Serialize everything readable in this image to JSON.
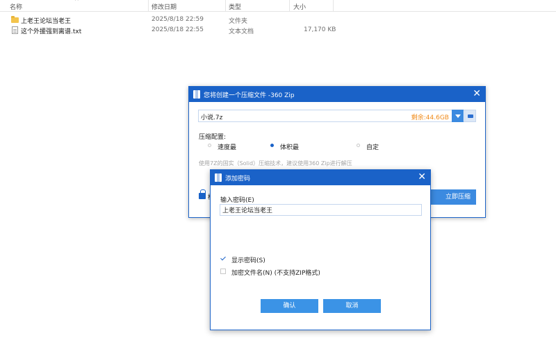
{
  "explorer": {
    "columns": [
      "名称",
      "修改日期",
      "类型",
      "大小"
    ],
    "files": [
      {
        "name": "上老王论坛当老王",
        "modified": "2025/8/18 22:59",
        "type": "文件夹",
        "size": ""
      },
      {
        "name": "这个外援强到离谱.txt",
        "modified": "2025/8/18 22:55",
        "type": "文本文档",
        "size": "17,170 KB"
      }
    ]
  },
  "zip_dialog": {
    "title": "您将创建一个压缩文件 -360 Zip",
    "path_value": "小说.7z",
    "free_space": "剩余:44.6GB",
    "config_label": "压缩配置:",
    "options": [
      "速度最",
      "体积最",
      "自定"
    ],
    "selected_option": "体积最",
    "hint": "使用7Z的固实（Solid）压缩技术，建议使用360 Zip进行解压",
    "lock_text": "模",
    "compress_button": "立即压缩"
  },
  "password_dialog": {
    "title": "添加密码",
    "input_label": "输入密码(E)",
    "input_value": "上老王论坛当老王",
    "show_password_label": "显示密码(S)",
    "show_password_checked": true,
    "encrypt_names_label": "加密文件名(N) (不支持ZIP格式)",
    "encrypt_names_checked": false,
    "ok_button": "确认",
    "cancel_button": "取消"
  },
  "colors": {
    "title_bar": "#1a62c8",
    "button": "#3b93e6",
    "free_space": "#f08a18"
  }
}
